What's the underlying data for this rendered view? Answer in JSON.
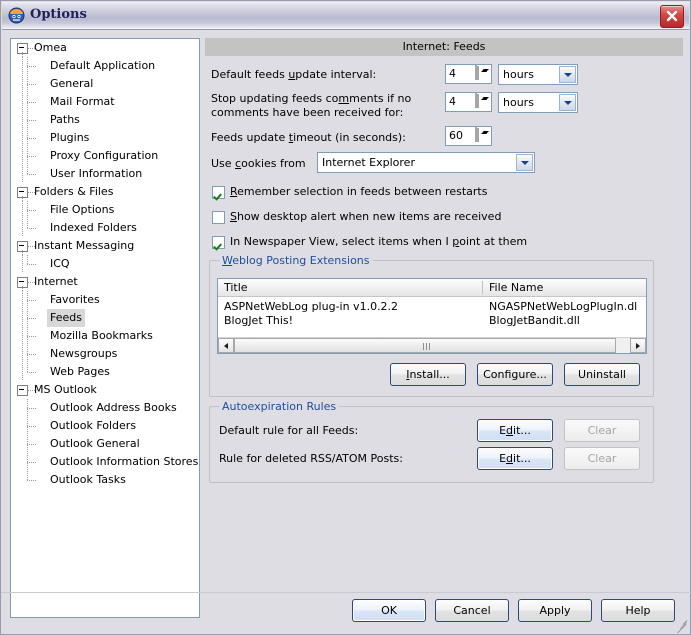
{
  "window": {
    "title": "Options",
    "icon": "omea-app-icon",
    "close_label": "x"
  },
  "tree": {
    "nodes": [
      {
        "label": "Omea",
        "level": 0,
        "expandable": true,
        "selected": false
      },
      {
        "label": "Default Application",
        "level": 1,
        "expandable": false,
        "selected": false
      },
      {
        "label": "General",
        "level": 1,
        "expandable": false,
        "selected": false
      },
      {
        "label": "Mail Format",
        "level": 1,
        "expandable": false,
        "selected": false
      },
      {
        "label": "Paths",
        "level": 1,
        "expandable": false,
        "selected": false
      },
      {
        "label": "Plugins",
        "level": 1,
        "expandable": false,
        "selected": false
      },
      {
        "label": "Proxy Configuration",
        "level": 1,
        "expandable": false,
        "selected": false
      },
      {
        "label": "User Information",
        "level": 1,
        "expandable": false,
        "selected": false
      },
      {
        "label": "Folders & Files",
        "level": 0,
        "expandable": true,
        "selected": false
      },
      {
        "label": "File Options",
        "level": 1,
        "expandable": false,
        "selected": false
      },
      {
        "label": "Indexed Folders",
        "level": 1,
        "expandable": false,
        "selected": false
      },
      {
        "label": "Instant Messaging",
        "level": 0,
        "expandable": true,
        "selected": false
      },
      {
        "label": "ICQ",
        "level": 1,
        "expandable": false,
        "selected": false
      },
      {
        "label": "Internet",
        "level": 0,
        "expandable": true,
        "selected": false
      },
      {
        "label": "Favorites",
        "level": 1,
        "expandable": false,
        "selected": false
      },
      {
        "label": "Feeds",
        "level": 1,
        "expandable": false,
        "selected": true
      },
      {
        "label": "Mozilla Bookmarks",
        "level": 1,
        "expandable": false,
        "selected": false
      },
      {
        "label": "Newsgroups",
        "level": 1,
        "expandable": false,
        "selected": false
      },
      {
        "label": "Web Pages",
        "level": 1,
        "expandable": false,
        "selected": false
      },
      {
        "label": "MS Outlook",
        "level": 0,
        "expandable": true,
        "selected": false
      },
      {
        "label": "Outlook Address Books",
        "level": 1,
        "expandable": false,
        "selected": false
      },
      {
        "label": "Outlook Folders",
        "level": 1,
        "expandable": false,
        "selected": false
      },
      {
        "label": "Outlook General",
        "level": 1,
        "expandable": false,
        "selected": false
      },
      {
        "label": "Outlook Information Stores",
        "level": 1,
        "expandable": false,
        "selected": false
      },
      {
        "label": "Outlook Tasks",
        "level": 1,
        "expandable": false,
        "selected": false
      }
    ]
  },
  "panel": {
    "header": "Internet: Feeds",
    "update_interval": {
      "label_pre": "Default feeds ",
      "label_accel": "u",
      "label_post": "pdate interval:",
      "value": "4",
      "unit": "hours"
    },
    "stop_comments": {
      "line1_pre": "Stop updating feeds co",
      "line1_accel": "m",
      "line1_post": "ments if no",
      "line2": "comments have been received for:",
      "value": "4",
      "unit": "hours"
    },
    "update_timeout": {
      "label_pre": "Feeds update ",
      "label_accel": "t",
      "label_post": "imeout (in seconds):",
      "value": "60"
    },
    "cookies": {
      "label_pre": "Use ",
      "label_accel": "c",
      "label_post": "ookies from",
      "value": "Internet Explorer"
    },
    "checkboxes": [
      {
        "pre": "",
        "accel": "R",
        "post": "emember selection in feeds between restarts",
        "checked": true
      },
      {
        "pre": "",
        "accel": "S",
        "post": "how desktop alert when new items are received",
        "checked": false
      },
      {
        "pre": "In Newspaper View, select items when I ",
        "accel": "p",
        "post": "oint at them",
        "checked": true
      }
    ]
  },
  "weblog_group": {
    "legend_accel": "W",
    "legend_post": "eblog Posting Extensions",
    "columns": [
      "Title",
      "File Name"
    ],
    "rows": [
      {
        "title": "ASPNetWebLog plug-in v1.0.2.2",
        "file_name": "NGASPNetWebLogPlugIn.dl"
      },
      {
        "title": "BlogJet This!",
        "file_name": "BlogJetBandit.dll"
      }
    ],
    "buttons": [
      {
        "pre": "",
        "accel": "I",
        "post": "nstall...",
        "disabled": false,
        "strong": false
      },
      {
        "pre": "Configure...",
        "accel": "",
        "post": "",
        "disabled": false,
        "strong": false
      },
      {
        "pre": "Uninstall",
        "accel": "",
        "post": "",
        "disabled": false,
        "strong": false
      }
    ]
  },
  "autoexpiration_group": {
    "legend": "Autoexpiration Rules",
    "rules": [
      {
        "label": "Default rule for all Feeds:",
        "edit": {
          "pre": "E",
          "accel": "d",
          "post": "it..."
        },
        "clear": "Clear",
        "clear_disabled": true
      },
      {
        "label": "Rule for deleted RSS/ATOM Posts:",
        "edit": {
          "pre": "E",
          "accel": "d",
          "post": "it..."
        },
        "clear": "Clear",
        "clear_disabled": true
      }
    ]
  },
  "footer": {
    "buttons": [
      {
        "label": "OK",
        "default": true
      },
      {
        "label": "Cancel",
        "default": false
      },
      {
        "label": "Apply",
        "default": false
      },
      {
        "label": "Help",
        "default": false
      }
    ]
  }
}
